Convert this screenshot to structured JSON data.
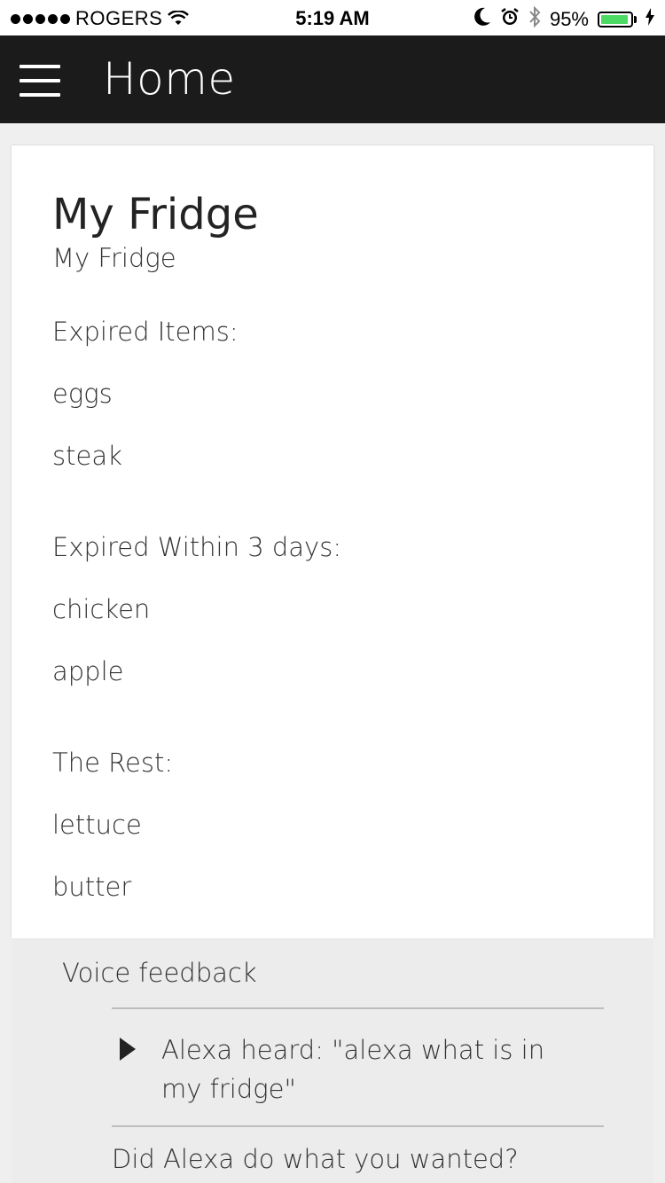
{
  "status_bar": {
    "carrier": "ROGERS",
    "time": "5:19 AM",
    "battery_percent": "95%",
    "battery_level": 0.95,
    "battery_color": "#4cd964",
    "icons": [
      "signal-dots",
      "wifi-icon",
      "moon-icon",
      "alarm-icon",
      "bluetooth-icon",
      "battery-icon",
      "charging-icon"
    ]
  },
  "header": {
    "title": "Home",
    "menu_icon": "hamburger-menu-icon",
    "background": "#1b1b1b"
  },
  "card": {
    "title": "My Fridge",
    "subtitle": "My Fridge",
    "sections": [
      {
        "heading": "Expired Items:",
        "items": [
          "eggs",
          "steak"
        ]
      },
      {
        "heading": "Expired Within 3 days:",
        "items": [
          "chicken",
          "apple"
        ]
      },
      {
        "heading": "The Rest:",
        "items": [
          "lettuce",
          "butter"
        ]
      }
    ]
  },
  "feedback": {
    "title": "Voice feedback",
    "heard": "Alexa heard: \"alexa what is in my fridge\"",
    "play_icon": "play-icon",
    "question": "Did Alexa do what you wanted?"
  }
}
